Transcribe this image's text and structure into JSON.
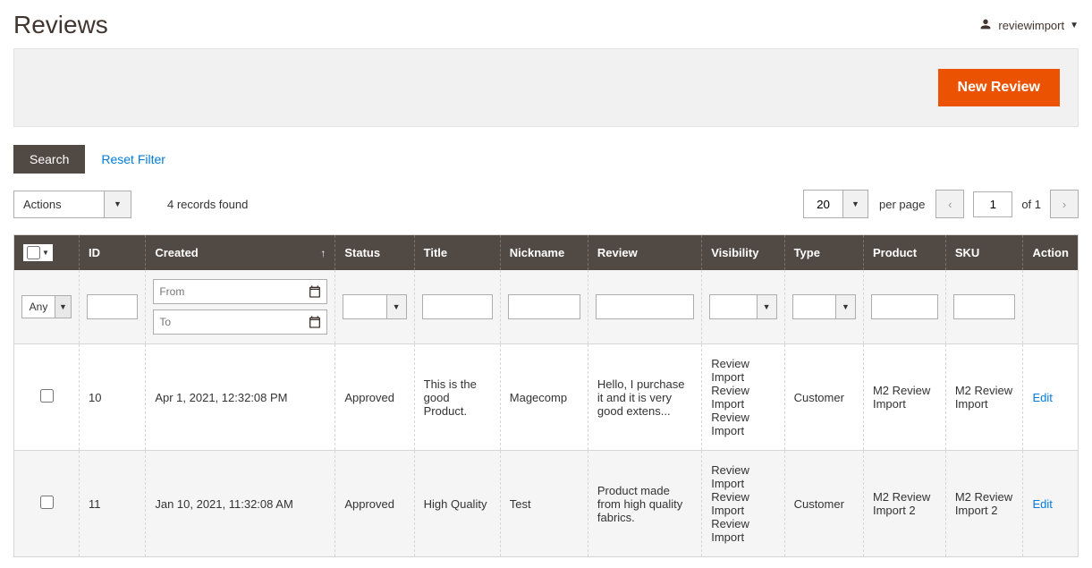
{
  "header": {
    "title": "Reviews",
    "user": "reviewimport"
  },
  "actionbar": {
    "new_review": "New Review"
  },
  "toolbar": {
    "search": "Search",
    "reset_filter": "Reset Filter",
    "actions_label": "Actions",
    "records_found": "4 records found",
    "per_page_value": "20",
    "per_page_label": "per page",
    "current_page": "1",
    "of_pages": "of 1"
  },
  "columns": {
    "id": "ID",
    "created": "Created",
    "status": "Status",
    "title": "Title",
    "nickname": "Nickname",
    "review": "Review",
    "visibility": "Visibility",
    "type": "Type",
    "product": "Product",
    "sku": "SKU",
    "action": "Action"
  },
  "filters": {
    "any": "Any",
    "from_placeholder": "From",
    "to_placeholder": "To"
  },
  "rows": [
    {
      "id": "10",
      "created": "Apr 1, 2021, 12:32:08 PM",
      "status": "Approved",
      "title": "This is the good Product.",
      "nickname": "Magecomp",
      "review": "Hello, I purchase it and it is very good extens...",
      "visibility": "Review Import\n   Review Import\n   Review Import",
      "type": "Customer",
      "product": "M2 Review Import",
      "sku": "M2 Review Import",
      "action": "Edit"
    },
    {
      "id": "11",
      "created": "Jan 10, 2021, 11:32:08 AM",
      "status": "Approved",
      "title": "High Quality",
      "nickname": "Test",
      "review": "Product made from high quality fabrics.",
      "visibility": "Review Import\n   Review Import\n   Review Import",
      "type": "Customer",
      "product": "M2 Review Import 2",
      "sku": "M2 Review Import 2",
      "action": "Edit"
    }
  ]
}
